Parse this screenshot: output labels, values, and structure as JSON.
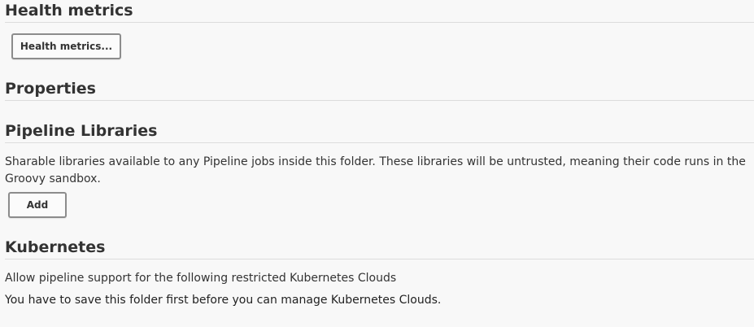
{
  "sections": {
    "health_metrics": {
      "title": "Health metrics",
      "button_label": "Health metrics..."
    },
    "properties": {
      "title": "Properties"
    },
    "pipeline_libraries": {
      "title": "Pipeline Libraries",
      "description": "Sharable libraries available to any Pipeline jobs inside this folder. These libraries will be untrusted, meaning their code runs in the Groovy sandbox.",
      "add_label": "Add"
    },
    "kubernetes": {
      "title": "Kubernetes",
      "description": "Allow pipeline support for the following restricted Kubernetes Clouds",
      "notice": "You have to save this folder first before you can manage Kubernetes Clouds."
    }
  }
}
